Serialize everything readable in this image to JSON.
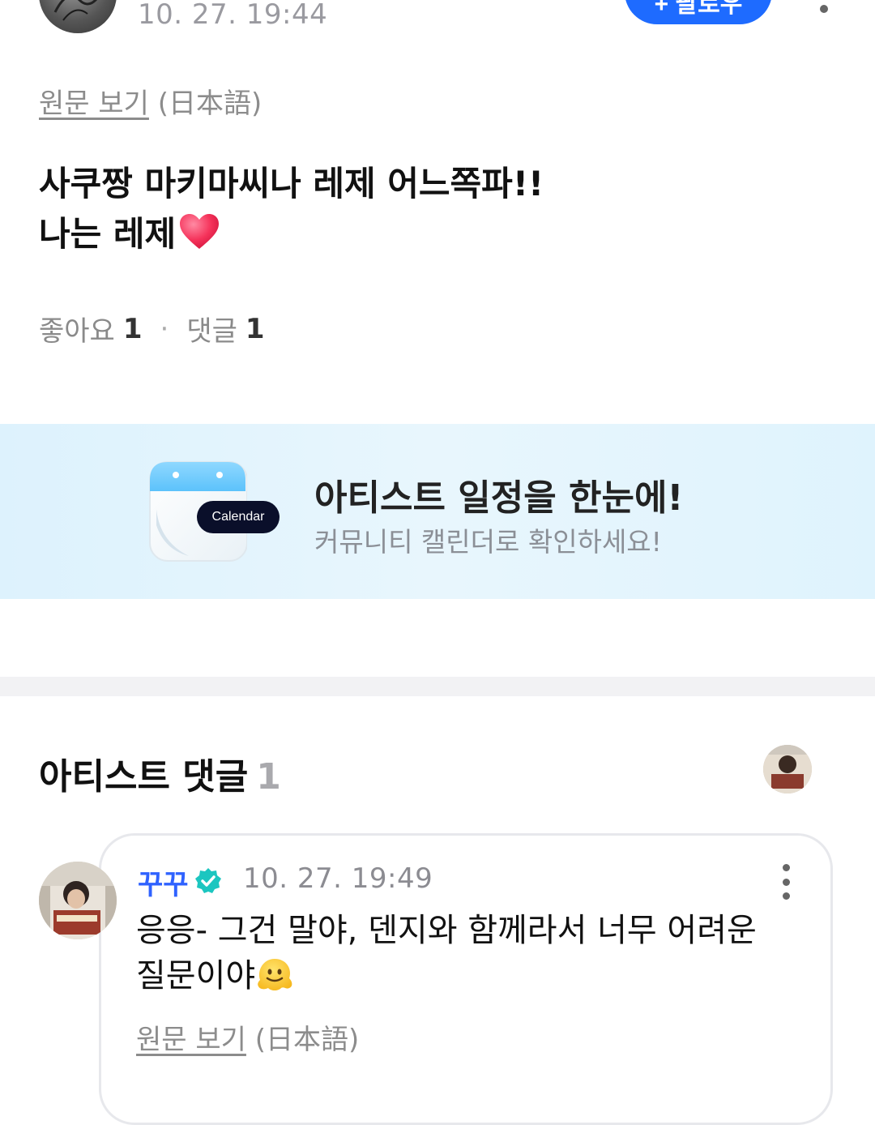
{
  "post": {
    "timestamp": "10. 27. 19:44",
    "follow_label": "+ 팔로우",
    "view_original": "원문 보기",
    "original_language": "(日本語)",
    "body_line1": "사쿠짱 마키마씨나 레제 어느쪽파!!",
    "body_line2": "나는 레제",
    "likes_label": "좋아요",
    "likes_count": "1",
    "comments_label": "댓글",
    "comments_count": "1"
  },
  "banner": {
    "calendar_label": "Calendar",
    "title": "아티스트 일정을 한눈에!",
    "subtitle": "커뮤니티 캘린더로 확인하세요!"
  },
  "artist_comments": {
    "title": "아티스트 댓글",
    "count": "1"
  },
  "comment": {
    "author": "꾸꾸",
    "timestamp": "10. 27. 19:49",
    "body_line1": "응응- 그건 말야, 덴지와 함께라서 너무 어려운",
    "body_line2": "질문이야",
    "view_original": "원문 보기",
    "original_language": "(日本語)"
  },
  "colors": {
    "accent_blue": "#1e6bff",
    "verified_teal": "#1cc6c0",
    "muted_text": "#8c8c8c",
    "banner_bg": "#e3f4fd"
  },
  "icons": [
    "more-vertical-icon",
    "heart-emoji-icon",
    "calendar-icon",
    "verified-badge-icon",
    "melting-face-emoji-icon"
  ]
}
